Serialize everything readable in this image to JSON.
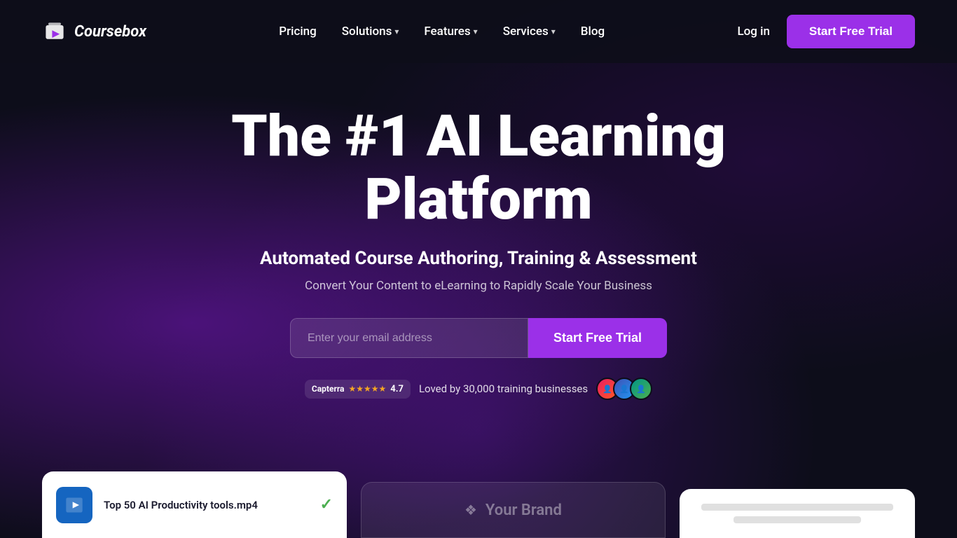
{
  "nav": {
    "logo_text": "Coursebox",
    "links": [
      {
        "label": "Pricing",
        "has_dropdown": false
      },
      {
        "label": "Solutions",
        "has_dropdown": true
      },
      {
        "label": "Features",
        "has_dropdown": true
      },
      {
        "label": "Services",
        "has_dropdown": true
      },
      {
        "label": "Blog",
        "has_dropdown": false
      }
    ],
    "login_label": "Log in",
    "trial_label": "Start Free Trial"
  },
  "hero": {
    "heading_line1": "The #1 AI Learning",
    "heading_line2": "Platform",
    "subtitle": "Automated Course Authoring, Training & Assessment",
    "description": "Convert Your Content to eLearning to Rapidly Scale Your Business",
    "email_placeholder": "Enter your email address",
    "trial_label": "Start Free Trial",
    "social_proof": {
      "rating": "4.7",
      "stars": "★★★★★",
      "text": "Loved by 30,000 training businesses"
    }
  },
  "preview": {
    "file_name": "Top 50 AI Productivity tools.mp4",
    "brand_label": "Your Brand"
  }
}
